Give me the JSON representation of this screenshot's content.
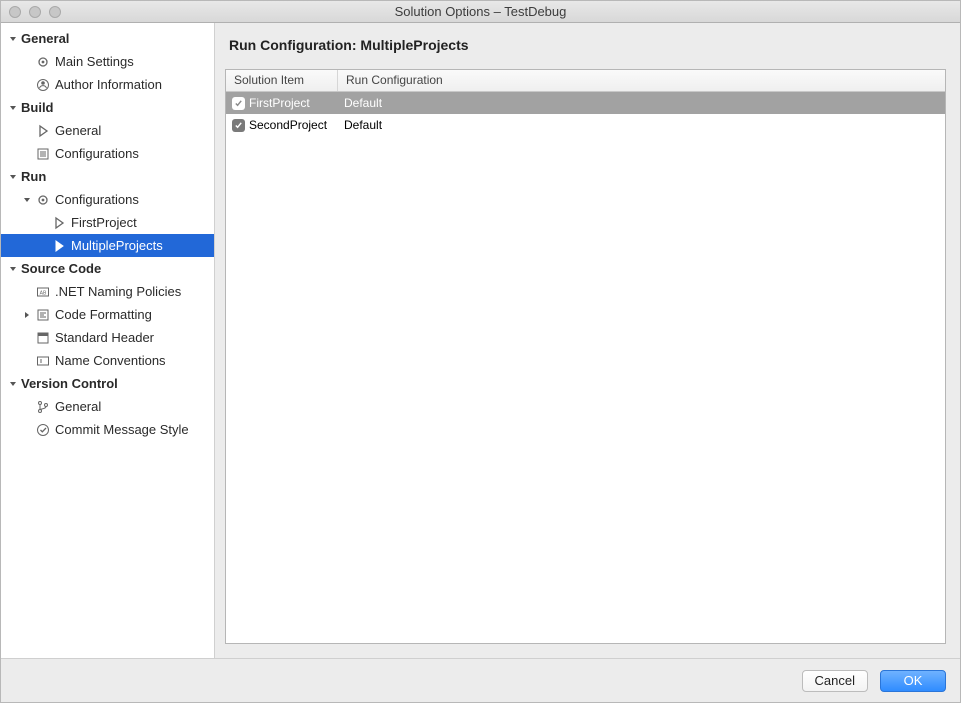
{
  "window": {
    "title": "Solution Options – TestDebug"
  },
  "sidebar": {
    "general": {
      "label": "General",
      "main_settings": "Main Settings",
      "author_information": "Author Information"
    },
    "build": {
      "label": "Build",
      "general": "General",
      "configurations": "Configurations"
    },
    "run": {
      "label": "Run",
      "configurations": "Configurations",
      "first_project": "FirstProject",
      "multiple_projects": "MultipleProjects"
    },
    "source_code": {
      "label": "Source Code",
      "net_naming": ".NET Naming Policies",
      "code_formatting": "Code Formatting",
      "standard_header": "Standard Header",
      "name_conventions": "Name Conventions"
    },
    "version_control": {
      "label": "Version Control",
      "general": "General",
      "commit_style": "Commit Message Style"
    }
  },
  "main": {
    "heading": "Run Configuration: MultipleProjects",
    "columns": {
      "solution_item": "Solution Item",
      "run_configuration": "Run Configuration"
    },
    "rows": [
      {
        "checked": true,
        "name": "FirstProject",
        "config": "Default",
        "selected": true
      },
      {
        "checked": true,
        "name": "SecondProject",
        "config": "Default",
        "selected": false
      }
    ]
  },
  "footer": {
    "cancel": "Cancel",
    "ok": "OK"
  }
}
